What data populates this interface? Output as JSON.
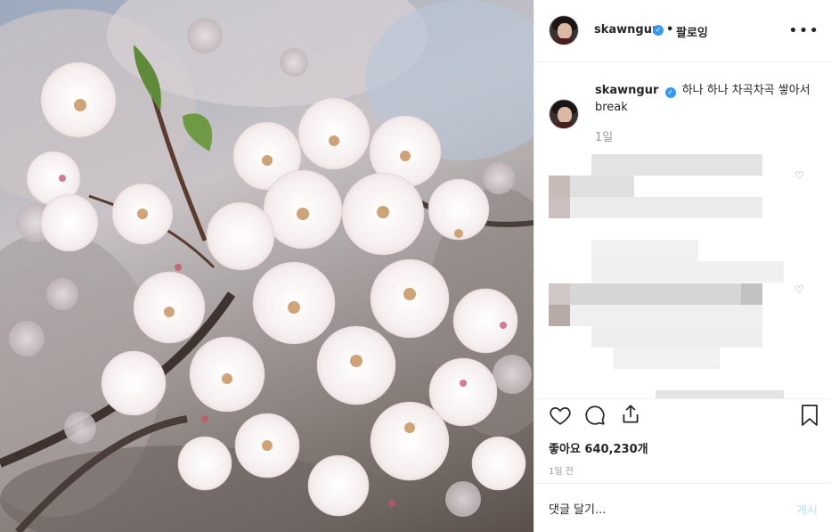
{
  "header": {
    "username": "skawngur",
    "separator": "•",
    "follow_label": "팔로잉",
    "more_icon": "more-options-icon"
  },
  "caption": {
    "username": "skawngur",
    "text": "하나 하나 차곡차곡 쌓아서 break",
    "time": "1일"
  },
  "comments": {
    "note": "",
    "heart_icon": "heart-outline-icon"
  },
  "actions": {
    "like_icon": "heart-icon",
    "comment_icon": "comment-icon",
    "share_icon": "share-icon",
    "save_icon": "bookmark-icon",
    "likes_text": "좋아요 640,230개",
    "post_time": "1일 전"
  },
  "comment_bar": {
    "placeholder": "댓글 달기...",
    "post_label": "게시"
  }
}
